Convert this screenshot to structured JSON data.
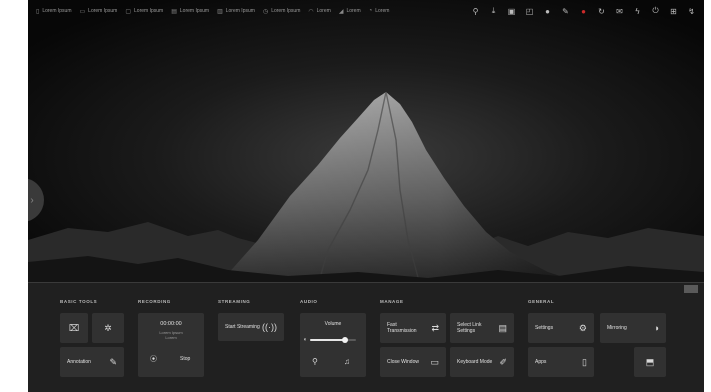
{
  "status_bar": {
    "items": [
      {
        "icon": "phone-icon",
        "text": "Lorem Ipsum"
      },
      {
        "icon": "battery-icon",
        "text": "Lorem Ipsum"
      },
      {
        "icon": "cpu-icon",
        "text": "Lorem Ipsum"
      },
      {
        "icon": "memory-icon",
        "text": "Lorem Ipsum"
      },
      {
        "icon": "storage-icon",
        "text": "Lorem Ipsum"
      },
      {
        "icon": "network-icon",
        "text": "Lorem Ipsum"
      },
      {
        "icon": "wifi-icon",
        "text": "Lorem"
      },
      {
        "icon": "signal-icon",
        "text": "Lorem"
      },
      {
        "icon": "clock-icon",
        "text": "Lorem"
      }
    ],
    "icons": [
      "person-icon",
      "download-icon",
      "screen-cast-icon",
      "pip-icon",
      "settings-dot-icon",
      "pen-icon",
      "record-icon",
      "rotate-icon",
      "message-icon",
      "bolt-icon",
      "power-icon",
      "grid-icon",
      "flash-icon"
    ]
  },
  "panel": {
    "sections": {
      "basic_tools": "BASIC TOOLS",
      "recording": "RECORDING",
      "streaming": "STREAMING",
      "audio": "AUDIO",
      "manage": "MANAGE",
      "general": "GENERAL"
    },
    "basic_tools": {
      "annotation_label": "Annotation"
    },
    "recording": {
      "time": "00:00:00",
      "sub1": "Lorem Ipsum",
      "sub2": "Lorem",
      "stop_label": "Stop"
    },
    "streaming": {
      "start_label": "Start Streaming"
    },
    "audio": {
      "volume_label": "Volume",
      "volume_level": 0.75
    },
    "manage": {
      "fast_transmission_label": "Fast Transmission",
      "select_link_settings_label": "Select Link Settings",
      "close_window_label": "Close Window",
      "keyboard_mode_label": "Keyboard Mode"
    },
    "general": {
      "settings_label": "Settings",
      "mirroring_label": "Mirroring",
      "apps_label": "Apps"
    }
  }
}
